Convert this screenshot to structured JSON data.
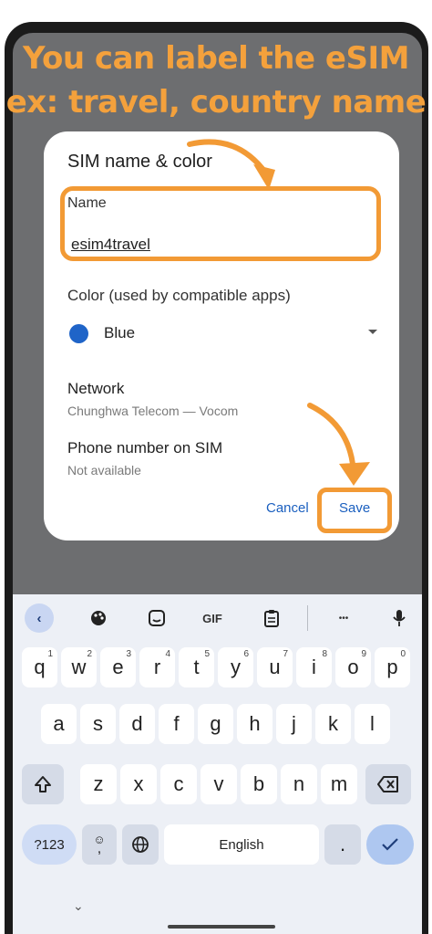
{
  "caption": {
    "line1": "You can label the eSIM",
    "line2": "ex: travel, country name"
  },
  "dialog": {
    "title": "SIM name & color",
    "name_label": "Name",
    "name_value": "esim4travel",
    "color_label": "Color (used by compatible apps)",
    "color_value": "Blue",
    "color_swatch": "#1f64c8",
    "network_label": "Network",
    "network_value": "Chunghwa Telecom — Vocom",
    "phone_label": "Phone number on SIM",
    "phone_value": "Not available",
    "cancel_label": "Cancel",
    "save_label": "Save"
  },
  "annotation_color": "#f29a35",
  "keyboard": {
    "toolbar": [
      "<",
      "palette-icon",
      "sticker-icon",
      "GIF",
      "clipboard-icon",
      "...",
      "mic-icon"
    ],
    "gif_label": "GIF",
    "more_label": "•••",
    "row1": [
      "q",
      "w",
      "e",
      "r",
      "t",
      "y",
      "u",
      "i",
      "o",
      "p"
    ],
    "row1_hints": [
      "1",
      "2",
      "3",
      "4",
      "5",
      "6",
      "7",
      "8",
      "9",
      "0"
    ],
    "row2": [
      "a",
      "s",
      "d",
      "f",
      "g",
      "h",
      "j",
      "k",
      "l"
    ],
    "row3": [
      "z",
      "x",
      "c",
      "v",
      "b",
      "n",
      "m"
    ],
    "symbols_label": "?123",
    "comma_label": ",",
    "space_label": "English",
    "period_label": "."
  }
}
